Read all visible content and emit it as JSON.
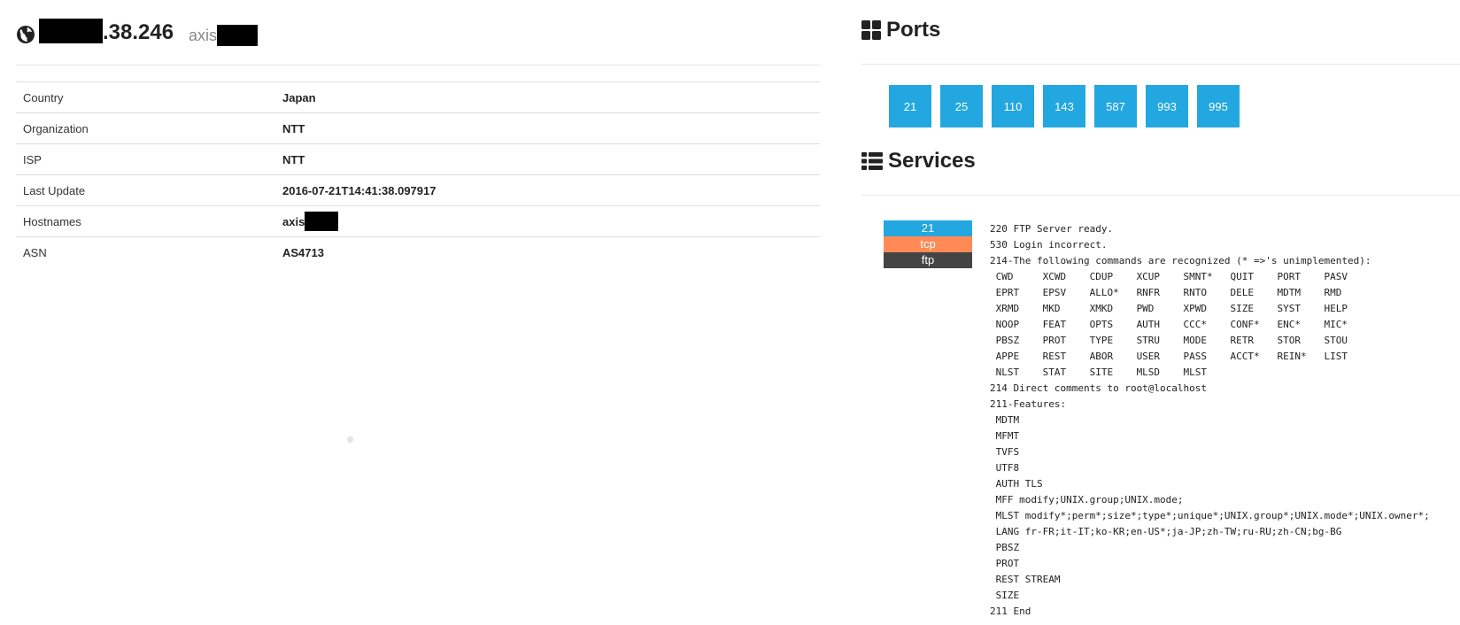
{
  "host": {
    "ip_suffix": ".38.246",
    "hostname_prefix": "axis"
  },
  "info": {
    "rows": [
      {
        "key": "Country",
        "value": "Japan"
      },
      {
        "key": "Organization",
        "value": "NTT"
      },
      {
        "key": "ISP",
        "value": "NTT"
      },
      {
        "key": "Last Update",
        "value": "2016-07-21T14:41:38.097917"
      },
      {
        "key": "Hostnames",
        "value": "axis"
      },
      {
        "key": "ASN",
        "value": "AS4713"
      }
    ]
  },
  "ports": {
    "title": "Ports",
    "list": [
      "21",
      "25",
      "110",
      "143",
      "587",
      "993",
      "995"
    ]
  },
  "services": {
    "title": "Services",
    "items": [
      {
        "port": "21",
        "transport": "tcp",
        "product": "ftp",
        "banner": "220 FTP Server ready.\n530 Login incorrect.\n214-The following commands are recognized (* =>'s unimplemented):\n CWD     XCWD    CDUP    XCUP    SMNT*   QUIT    PORT    PASV\n EPRT    EPSV    ALLO*   RNFR    RNTO    DELE    MDTM    RMD\n XRMD    MKD     XMKD    PWD     XPWD    SIZE    SYST    HELP\n NOOP    FEAT    OPTS    AUTH    CCC*    CONF*   ENC*    MIC*\n PBSZ    PROT    TYPE    STRU    MODE    RETR    STOR    STOU\n APPE    REST    ABOR    USER    PASS    ACCT*   REIN*   LIST\n NLST    STAT    SITE    MLSD    MLST\n214 Direct comments to root@localhost\n211-Features:\n MDTM\n MFMT\n TVFS\n UTF8\n AUTH TLS\n MFF modify;UNIX.group;UNIX.mode;\n MLST modify*;perm*;size*;type*;unique*;UNIX.group*;UNIX.mode*;UNIX.owner*;\n LANG fr-FR;it-IT;ko-KR;en-US*;ja-JP;zh-TW;ru-RU;zh-CN;bg-BG\n PBSZ\n PROT\n REST STREAM\n SIZE\n211 End"
      }
    ]
  },
  "colors": {
    "port_blue": "#23a7e0",
    "transport_orange": "#ff8a56",
    "service_dark": "#444444"
  },
  "icons": {
    "host": "globe-icon",
    "ports": "grid-icon",
    "services": "list-icon"
  }
}
